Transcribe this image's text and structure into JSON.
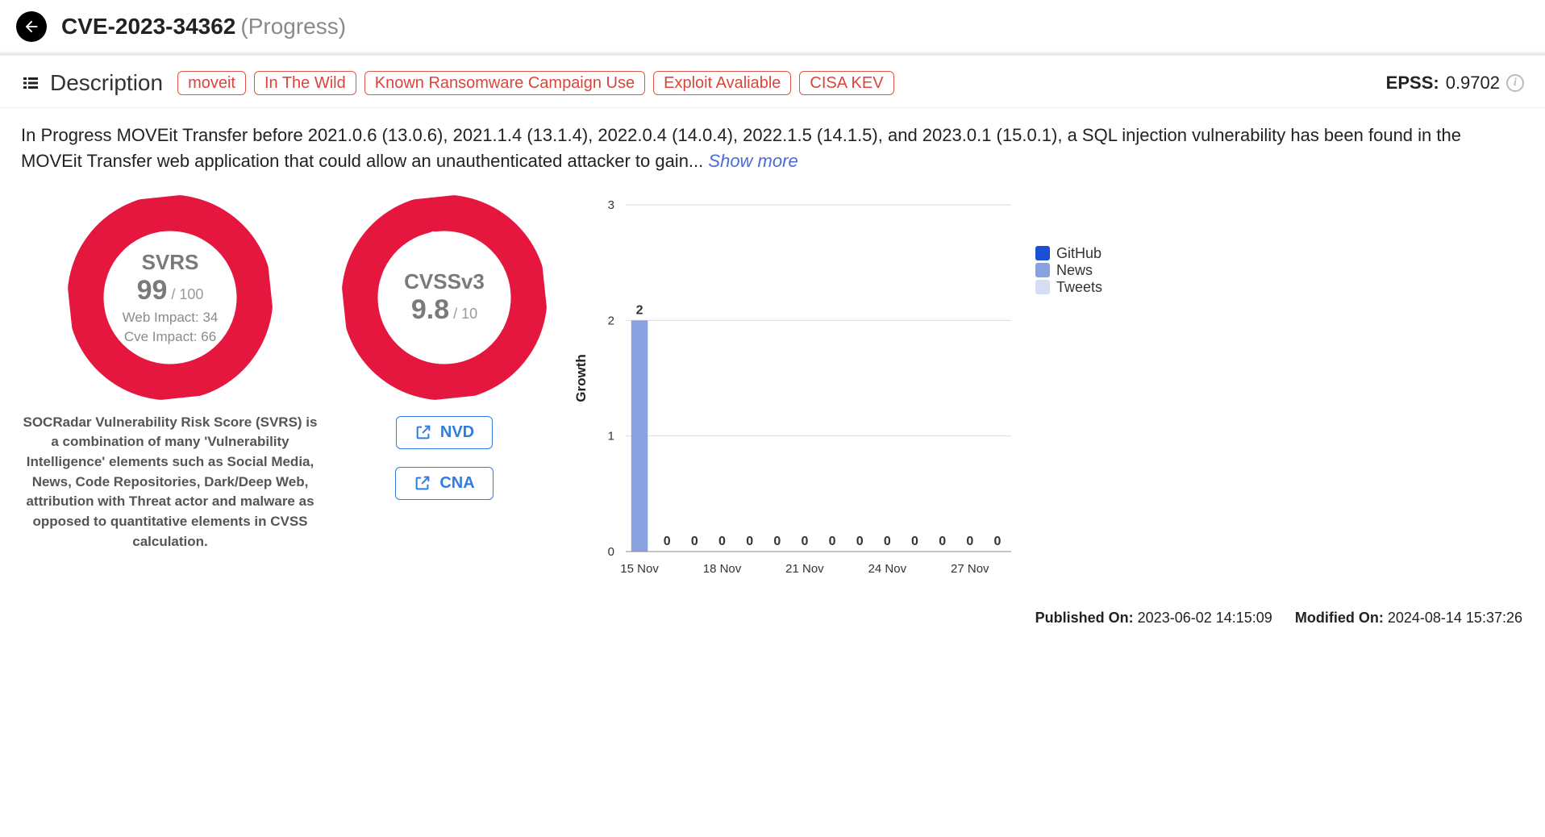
{
  "header": {
    "cve_id": "CVE-2023-34362",
    "vendor": "(Progress)"
  },
  "descBar": {
    "label": "Description",
    "tags": [
      "moveit",
      "In The Wild",
      "Known Ransomware Campaign Use",
      "Exploit Avaliable",
      "CISA KEV"
    ],
    "epss_label": "EPSS:",
    "epss_value": "0.9702"
  },
  "description": {
    "text": "In Progress MOVEit Transfer before 2021.0.6 (13.0.6), 2021.1.4 (13.1.4), 2022.0.4 (14.0.4), 2022.1.5 (14.1.5), and 2023.0.1 (15.0.1), a SQL injection vulnerability has been found in the MOVEit Transfer web application that could allow an unauthenticated attacker to gain...",
    "show_more": "Show more"
  },
  "svrs": {
    "title": "SVRS",
    "score": "99",
    "max": " / 100",
    "web_impact": "Web Impact: 34",
    "cve_impact": "Cve Impact: 66",
    "desc": "SOCRadar Vulnerability Risk Score (SVRS) is a combination of many 'Vulnerability Intelligence' elements such as Social Media, News, Code Repositories, Dark/Deep Web, attribution with Threat actor and malware as opposed to quantitative elements in CVSS calculation."
  },
  "cvss": {
    "title": "CVSSv3",
    "score": "9.8",
    "max": " / 10",
    "nvd_label": "NVD",
    "cna_label": "CNA"
  },
  "legend": {
    "items": [
      {
        "label": "GitHub",
        "color": "#1a4fd6"
      },
      {
        "label": "News",
        "color": "#8aa1e0"
      },
      {
        "label": "Tweets",
        "color": "#d6ddf2"
      }
    ]
  },
  "footer": {
    "pub_label": "Published On:",
    "pub_value": "2023-06-02 14:15:09",
    "mod_label": "Modified On:",
    "mod_value": "2024-08-14 15:37:26"
  },
  "chart_data": {
    "type": "bar",
    "ylabel": "Growth",
    "ylim": [
      0,
      3
    ],
    "yticks": [
      0,
      1,
      2,
      3
    ],
    "categories": [
      "15 Nov",
      "16 Nov",
      "17 Nov",
      "18 Nov",
      "19 Nov",
      "20 Nov",
      "21 Nov",
      "22 Nov",
      "23 Nov",
      "24 Nov",
      "25 Nov",
      "26 Nov",
      "27 Nov",
      "28 Nov"
    ],
    "xTickLabels": [
      "15 Nov",
      "",
      "",
      "18 Nov",
      "",
      "",
      "21 Nov",
      "",
      "",
      "24 Nov",
      "",
      "",
      "27 Nov",
      ""
    ],
    "series": [
      {
        "name": "News",
        "color": "#8aa1e0",
        "values": [
          2,
          0,
          0,
          0,
          0,
          0,
          0,
          0,
          0,
          0,
          0,
          0,
          0,
          0
        ]
      }
    ]
  }
}
